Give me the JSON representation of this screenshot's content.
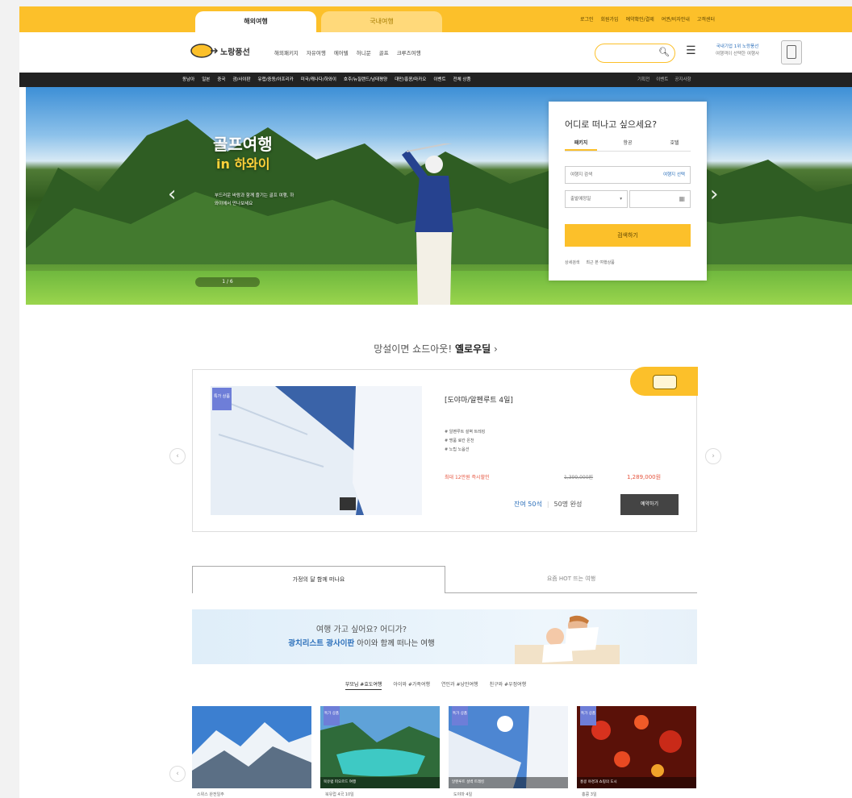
{
  "top": {
    "tabs": [
      "해외여행",
      "국내여행"
    ],
    "links": [
      "로그인",
      "회원가입",
      "예약확인/결제",
      "여권/비자안내",
      "고객센터"
    ]
  },
  "header": {
    "brand": "노랑풍선",
    "gnb": [
      "해외패키지",
      "자유여행",
      "에어텔",
      "허니문",
      "골프",
      "크루즈여행"
    ],
    "search_placeholder": "",
    "promo_line1": "국내기업 1위 노랑풍선",
    "promo_line2": "여행객이 선택한 여행사"
  },
  "catbar": {
    "left": [
      "동남아",
      "일본",
      "중국",
      "괌/사이판",
      "유럽/중동/아프리카",
      "미국/캐나다/하와이",
      "호주/뉴질랜드/남태평양",
      "대만/홍콩/마카오",
      "이벤트",
      "전체 상품"
    ],
    "right": [
      "기획전",
      "이벤트",
      "공지사항"
    ]
  },
  "hero": {
    "title": "골프여행",
    "subtitle": "in 하와이",
    "desc": "부드러운 바람과 함께 즐기는 골프 여행, 하와이에서 만나보세요",
    "counter": "1 / 6"
  },
  "search_box": {
    "question": "어디로 떠나고 싶으세요?",
    "tabs": [
      "패키지",
      "항공",
      "호텔"
    ],
    "dest_placeholder": "여행지 검색",
    "dest_link": "여행지 선택",
    "date_label": "출발예정일",
    "button": "검색하기",
    "foot": [
      "상세검색",
      "최근 본 여행상품"
    ]
  },
  "deal": {
    "heading_pre": "망설이면 쇼드아웃!",
    "heading_bold": "옐로우딜",
    "badge": "특가 상품",
    "name": "[도야마/알펜루트 4일]",
    "features": [
      "# 알펜루트 설벽 트레킹",
      "# 명품 료칸 온천",
      "# 노팁 노옵션"
    ],
    "discount": "최대 12만원 즉시할인",
    "old_price": "1,399,000원",
    "new_price": "1,289,000원",
    "seats": "잔여 50석",
    "min": "50명 완성",
    "book": "예약하기"
  },
  "tabs2": [
    "가정의 달 함께 떠나요",
    "요즘 HOT 뜨는 여행"
  ],
  "banner": {
    "line1": "여행 가고 싶어요? 어디가?",
    "line2_bold": "광치리스트 광사이판",
    "line2_rest": "아이와 함께 떠나는 여행"
  },
  "subtabs": [
    "부모님 #효도여행",
    "아이와 #가족여행",
    "연인과 #낭만여행",
    "친구와 #우정여행"
  ],
  "cards": [
    {
      "badge": "",
      "caption": "",
      "title": "스위스 완전일주"
    },
    {
      "badge": "특가 상품",
      "caption": "북유럽 피오르드 여행",
      "title": "북유럽 4국 10일"
    },
    {
      "badge": "특가 상품",
      "caption": "알펜루트 설벽 트레킹",
      "title": "도야마 4일"
    },
    {
      "badge": "특가 상품",
      "caption": "홍콩 야경과 쇼핑의 도시",
      "title": "홍콩 3일"
    }
  ]
}
